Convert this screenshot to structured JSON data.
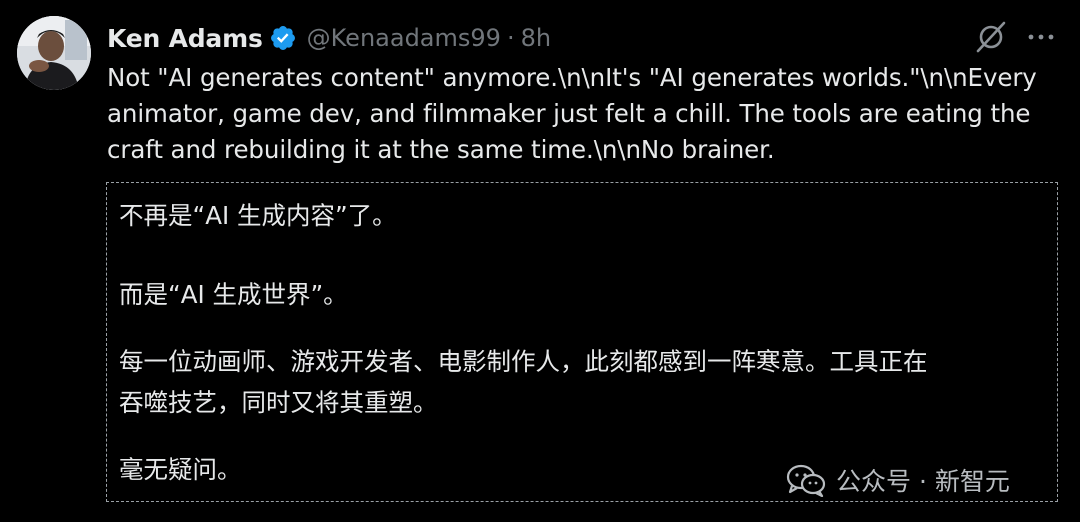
{
  "tweet": {
    "author_name": "Ken Adams",
    "verified_icon": "verified-badge-icon",
    "handle": "@Kenaadams99",
    "separator": "·",
    "time": "8h",
    "text_lines": [
      "Not \"AI generates content\" anymore.\\n\\nIt's \"AI generates worlds.\"\\n\\nEvery",
      "animator, game dev, and filmmaker just felt a chill. The tools are eating the",
      "craft and rebuilding it at the same time.\\n\\nNo brainer."
    ]
  },
  "actions": {
    "grok_icon": "grok-slash-icon",
    "more_icon": "more-horizontal-icon"
  },
  "translation": {
    "lines": [
      "不再是“AI 生成内容”了。",
      "而是“AI 生成世界”。",
      "每一位动画师、游戏开发者、电影制作人，此刻都感到一阵寒意。工具正在",
      "吞噬技艺，同时又将其重塑。",
      "毫无疑问。"
    ]
  },
  "watermark": {
    "icon": "wechat-icon",
    "text": "公众号 · 新智元"
  },
  "colors": {
    "background": "#000000",
    "primary_text": "#e7e9ea",
    "secondary_text": "#71767b",
    "verified_blue": "#1d9bf0",
    "dashed_border": "#9aa0a6"
  }
}
